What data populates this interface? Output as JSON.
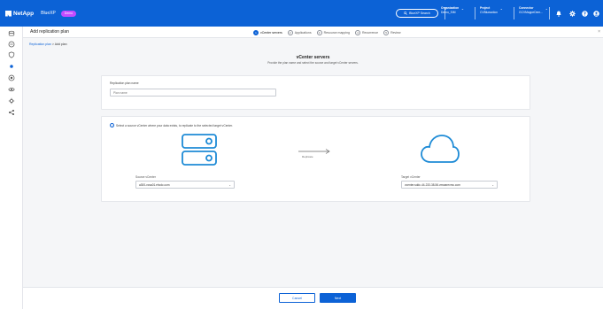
{
  "topbar": {
    "brand": "NetApp",
    "product": "BlueXP",
    "badge": "Demo",
    "search": "BlueXP Search",
    "org_label": "Organization",
    "org_value": "Demo_SIM",
    "project_label": "Project",
    "project_value": "CVBlueaction",
    "connector_label": "Connector",
    "connector_value": "GCVMappeDem..."
  },
  "subhead": {
    "title": "Add replication plan",
    "steps": [
      {
        "num": "1",
        "label": "vCenter servers"
      },
      {
        "num": "2",
        "label": "Applications"
      },
      {
        "num": "3",
        "label": "Resource mapping"
      },
      {
        "num": "4",
        "label": "Recurrence"
      },
      {
        "num": "5",
        "label": "Review"
      }
    ],
    "close": "×"
  },
  "breadcrumb": {
    "link": "Replication plan",
    "sep": ">",
    "current": "Add plan"
  },
  "page": {
    "heading": "vCenter servers",
    "subheading": "Provide the plan name and select the source and target vCenter servers."
  },
  "plan": {
    "label": "Replication plan name",
    "placeholder": "Plan name"
  },
  "vcenter": {
    "info": "Select a source vCenter where your data exists, to replicate to the selected target vCenter.",
    "arrow_label": "Replicate",
    "source_label": "Source vCenter",
    "source_value": "a300-vcsa01.ehcdc.com",
    "target_label": "Target vCenter",
    "target_value": "vcenter.sddc-44-233-38-56.vmwarevmc.com"
  },
  "footer": {
    "cancel": "Cancel",
    "next": "Next"
  },
  "colors": {
    "accent": "#0c62d6",
    "badge": "#c44cff"
  }
}
